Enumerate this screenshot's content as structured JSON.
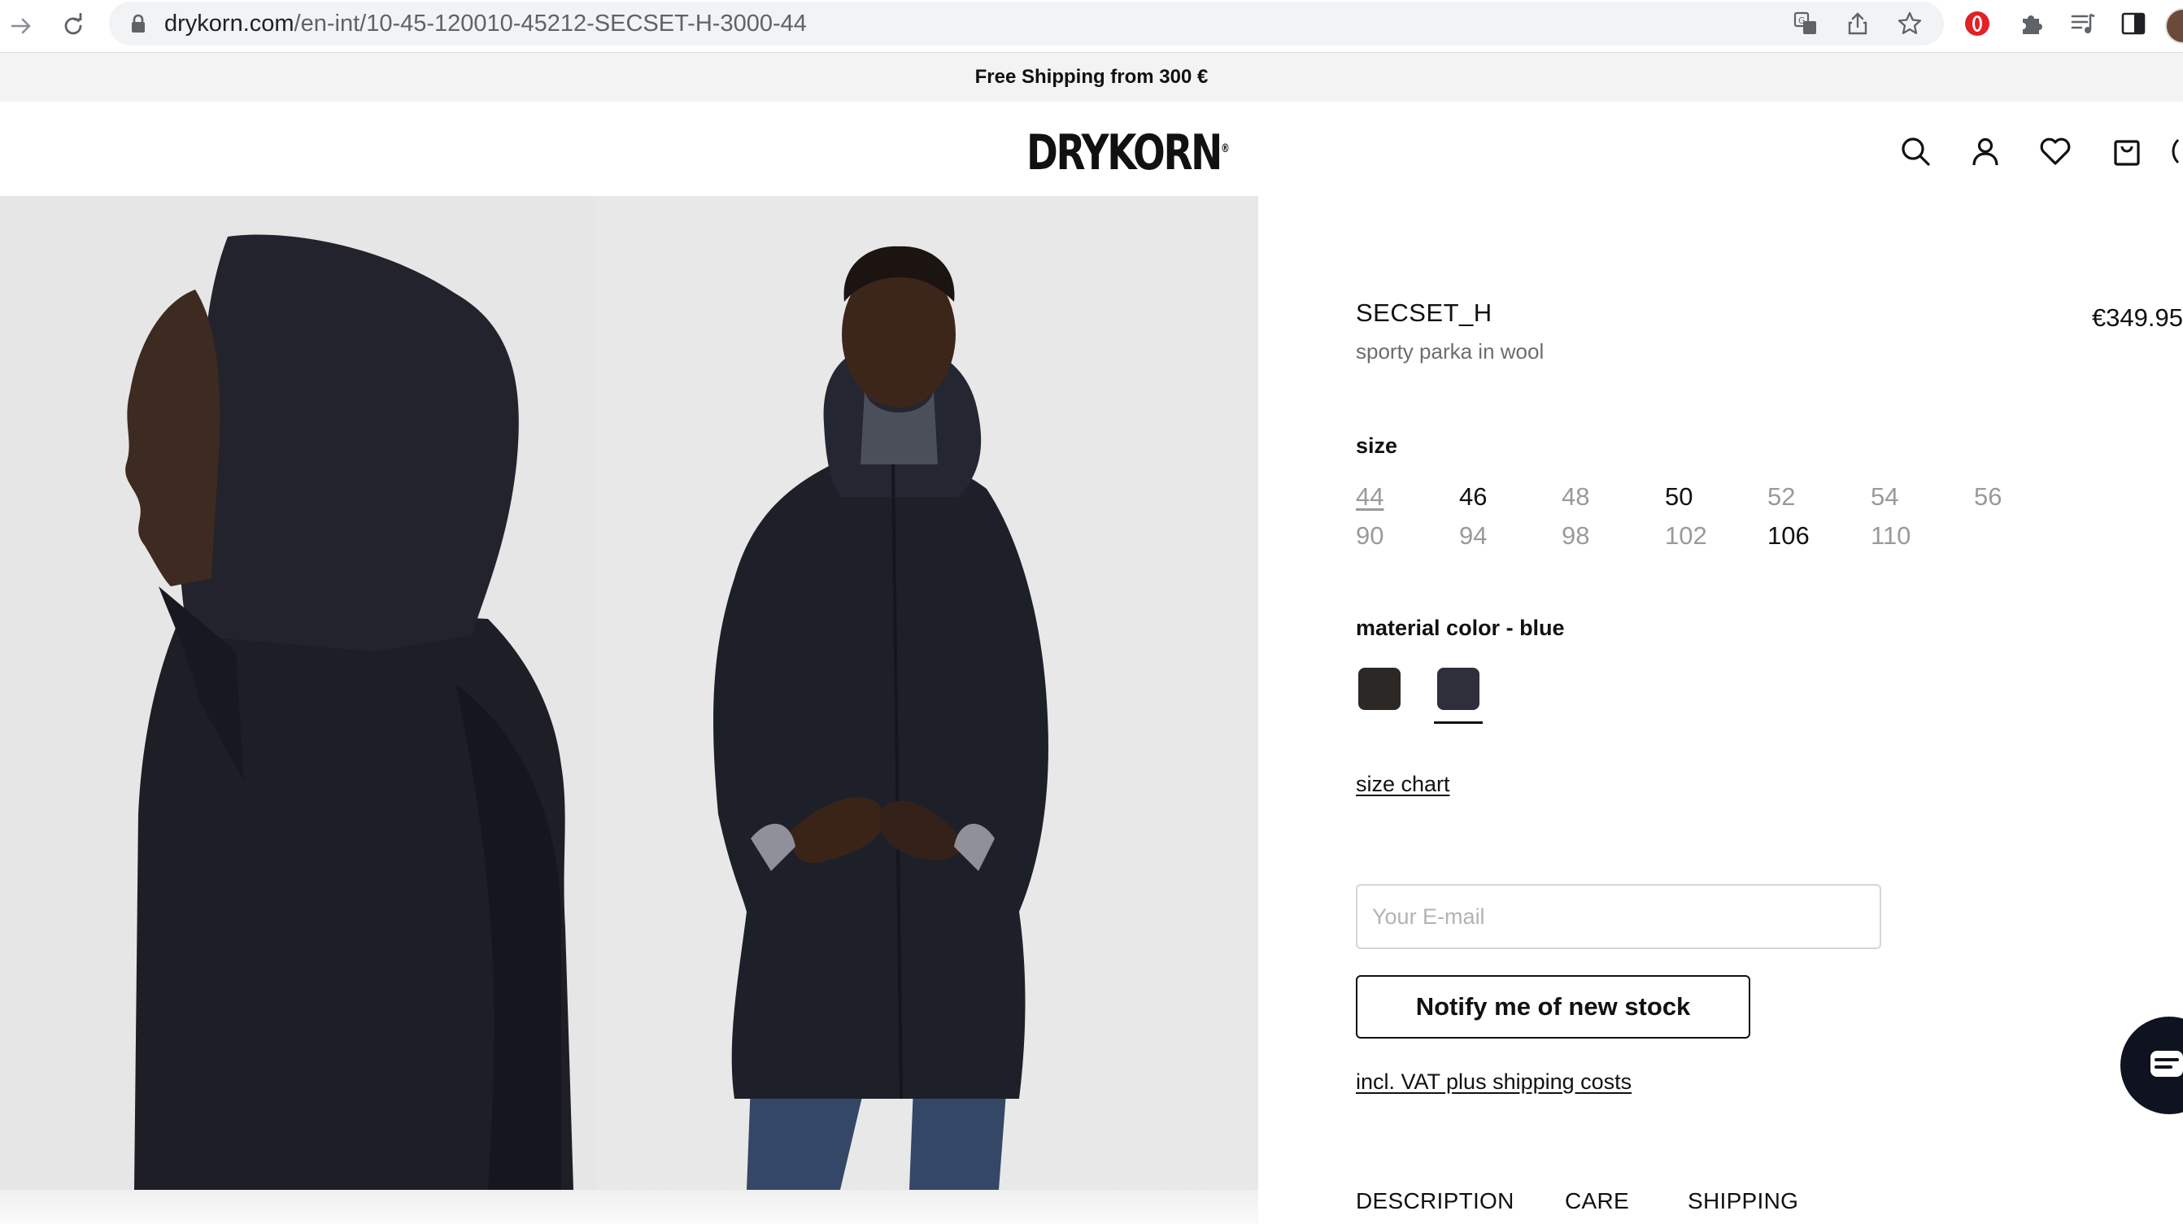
{
  "browser": {
    "url_host": "drykorn.com",
    "url_path": "/en-int/10-45-120010-45212-SECSET-H-3000-44"
  },
  "promo": {
    "text": "Free Shipping from 300 €"
  },
  "header": {
    "logo": "DRYKORN",
    "logo_mark": "®"
  },
  "product": {
    "name": "SECSET_H",
    "subtitle": "sporty parka in wool",
    "price": "€349.95"
  },
  "size": {
    "label": "size",
    "options": [
      {
        "eu": "44",
        "us": "90",
        "eu_available": false,
        "us_available": false,
        "selected": true
      },
      {
        "eu": "46",
        "us": "94",
        "eu_available": true,
        "us_available": false
      },
      {
        "eu": "48",
        "us": "98",
        "eu_available": false,
        "us_available": false
      },
      {
        "eu": "50",
        "us": "102",
        "eu_available": true,
        "us_available": false
      },
      {
        "eu": "52",
        "us": "106",
        "eu_available": false,
        "us_available": true
      },
      {
        "eu": "54",
        "us": "110",
        "eu_available": false,
        "us_available": false
      },
      {
        "eu": "56",
        "us": "",
        "eu_available": false,
        "us_available": false
      }
    ]
  },
  "color": {
    "label": "material color - blue",
    "swatches": [
      {
        "name": "black",
        "hex": "#2b2826",
        "selected": false
      },
      {
        "name": "blue",
        "hex": "#2e2f3b",
        "selected": true
      }
    ]
  },
  "size_chart": {
    "label": "size chart"
  },
  "notify": {
    "email_placeholder": "Your E-mail",
    "email_value": "",
    "button_label": "Notify me of new stock"
  },
  "vat_note": "incl. VAT plus shipping costs",
  "tabs": [
    "DESCRIPTION",
    "CARE",
    "SHIPPING"
  ]
}
